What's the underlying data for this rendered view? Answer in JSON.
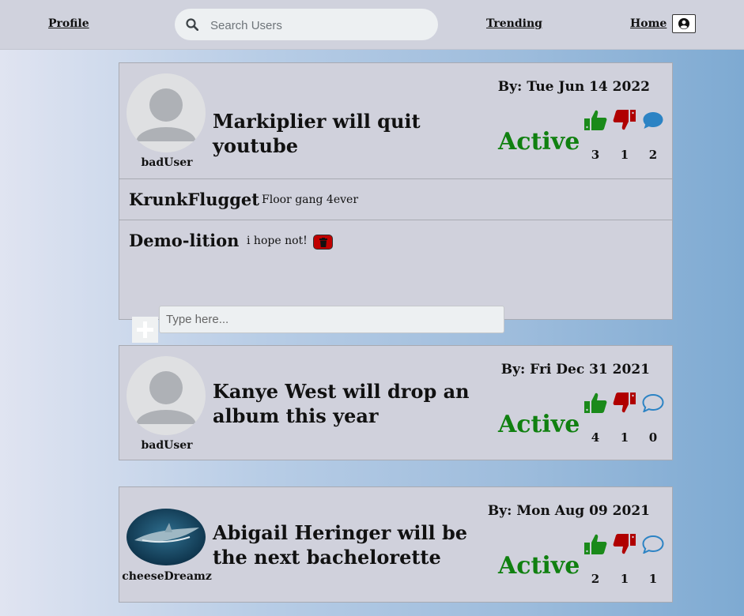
{
  "nav": {
    "profile": "Profile",
    "trending": "Trending",
    "home": "Home",
    "search_placeholder": "Search Users"
  },
  "icons": {
    "search": "search-icon",
    "user": "user-circle-icon",
    "like": "thumbs-up-icon",
    "dislike": "thumbs-down-icon",
    "comment": "comment-icon",
    "delete": "trash-icon",
    "add": "plus-icon"
  },
  "colors": {
    "active": "#108010",
    "like": "#1a8a1a",
    "dislike": "#b00000",
    "comment": "#2c83c4",
    "delete": "#c00000"
  },
  "posts": [
    {
      "author": "badUser",
      "title": "Markiplier will quit youtube",
      "date": "By: Tue Jun 14 2022",
      "status": "Active",
      "likes": "3",
      "dislikes": "1",
      "comments_count": "2",
      "comment_icon_filled": true,
      "comments": [
        {
          "user": "KrunkFlugget",
          "text": "Floor gang 4ever"
        },
        {
          "user": "Demo-lition",
          "text": "i hope not!"
        }
      ],
      "comment_placeholder": "Type here..."
    },
    {
      "author": "badUser",
      "title": "Kanye West will drop an album this year",
      "date": "By: Fri Dec 31 2021",
      "status": "Active",
      "likes": "4",
      "dislikes": "1",
      "comments_count": "0",
      "comment_icon_filled": false
    },
    {
      "author": "cheeseDreamz",
      "title": "Abigail Heringer will be the next bachelorette",
      "date": "By: Mon Aug 09 2021",
      "status": "Active",
      "likes": "2",
      "dislikes": "1",
      "comments_count": "1",
      "comment_icon_filled": false
    }
  ]
}
